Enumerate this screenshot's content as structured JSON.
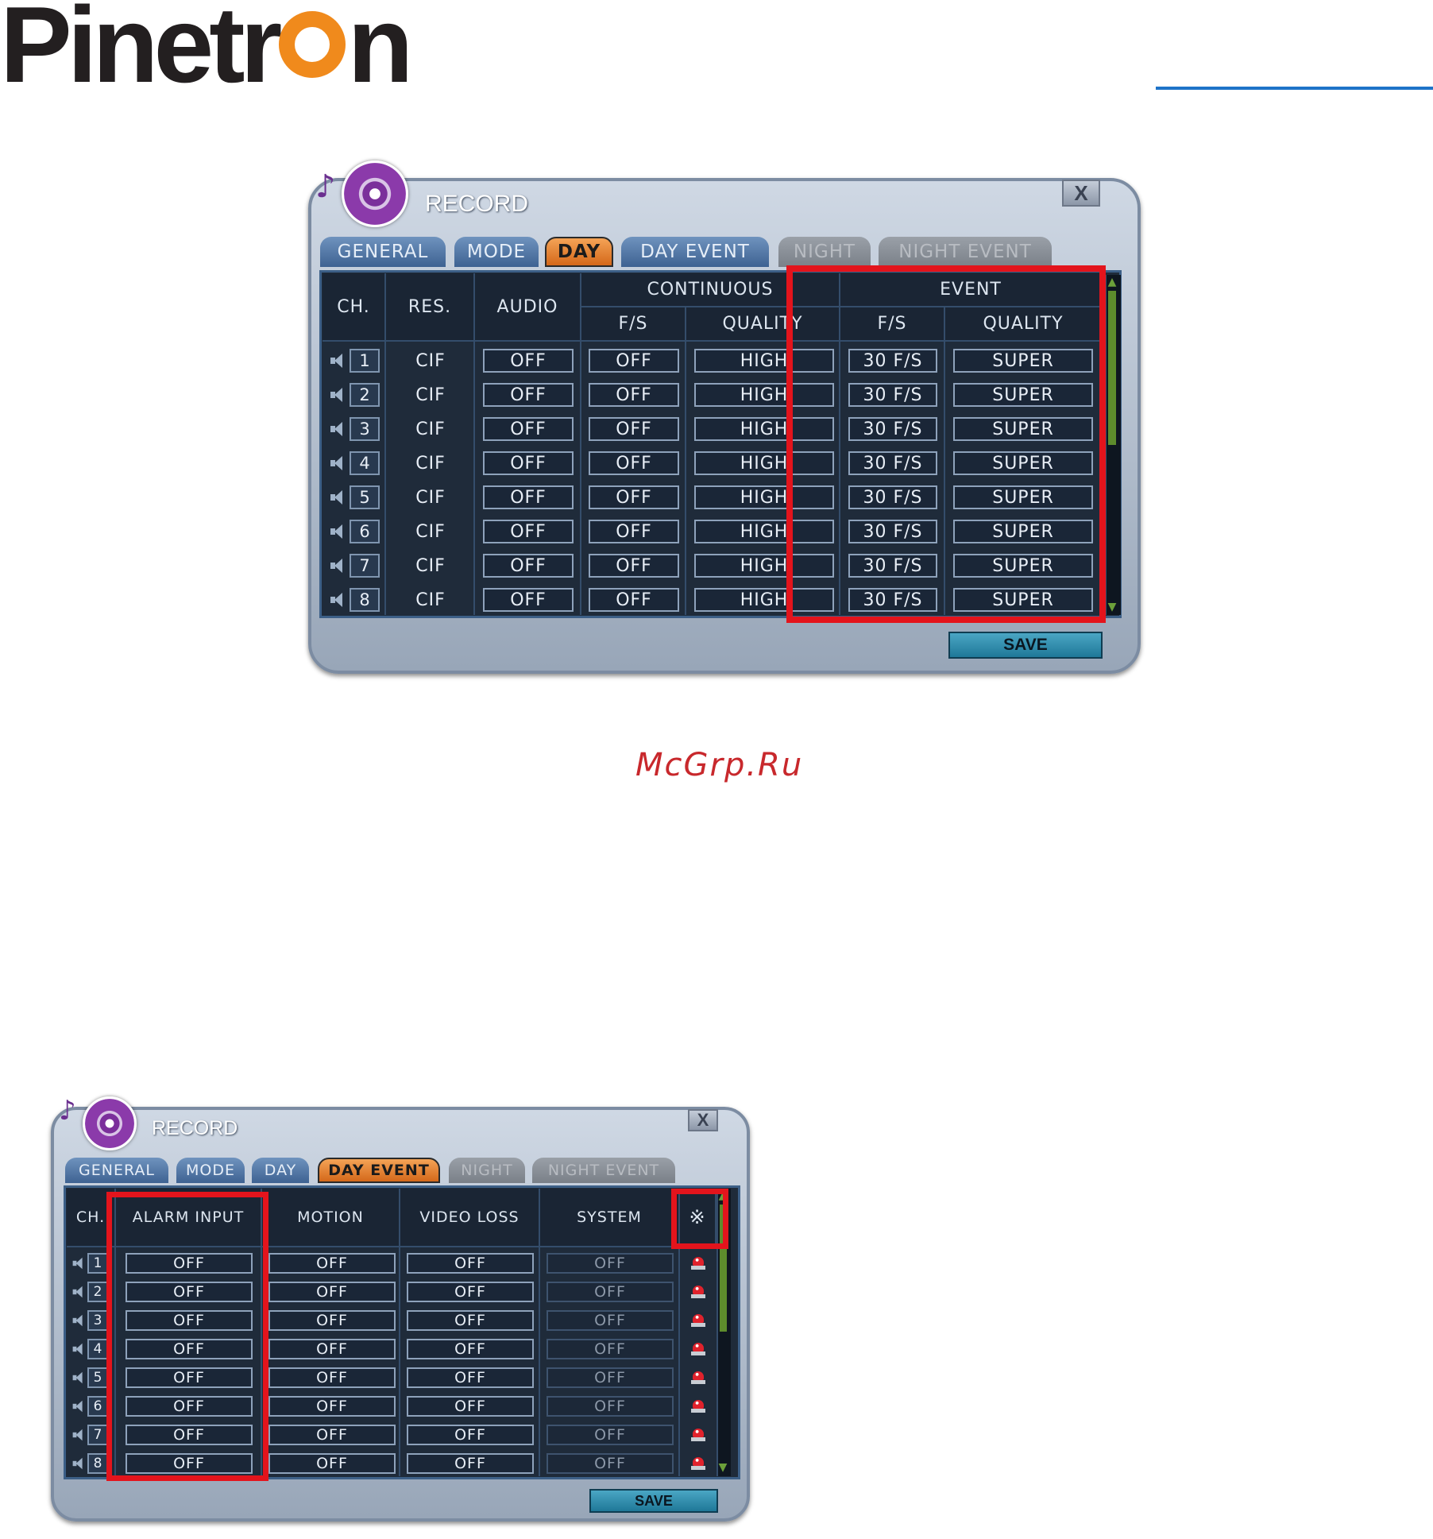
{
  "logo": {
    "text_start": "Pinetr",
    "text_end": "n"
  },
  "watermark": "McGrp.Ru",
  "window1": {
    "title": "RECORD",
    "close_label": "X",
    "tabs": [
      {
        "label": "GENERAL",
        "state": "normal"
      },
      {
        "label": "MODE",
        "state": "normal"
      },
      {
        "label": "DAY",
        "state": "active"
      },
      {
        "label": "DAY EVENT",
        "state": "normal"
      },
      {
        "label": "NIGHT",
        "state": "disabled"
      },
      {
        "label": "NIGHT EVENT",
        "state": "disabled"
      }
    ],
    "headers": {
      "ch": "CH.",
      "res": "RES.",
      "audio": "AUDIO",
      "continuous": "CONTINUOUS",
      "event": "EVENT",
      "cont_fs": "F/S",
      "cont_quality": "QUALITY",
      "event_fs": "F/S",
      "event_quality": "QUALITY"
    },
    "rows": [
      {
        "ch": "1",
        "res": "CIF",
        "audio": "OFF",
        "cont_fs": "OFF",
        "cont_quality": "HIGH",
        "event_fs": "30 F/S",
        "event_quality": "SUPER"
      },
      {
        "ch": "2",
        "res": "CIF",
        "audio": "OFF",
        "cont_fs": "OFF",
        "cont_quality": "HIGH",
        "event_fs": "30 F/S",
        "event_quality": "SUPER"
      },
      {
        "ch": "3",
        "res": "CIF",
        "audio": "OFF",
        "cont_fs": "OFF",
        "cont_quality": "HIGH",
        "event_fs": "30 F/S",
        "event_quality": "SUPER"
      },
      {
        "ch": "4",
        "res": "CIF",
        "audio": "OFF",
        "cont_fs": "OFF",
        "cont_quality": "HIGH",
        "event_fs": "30 F/S",
        "event_quality": "SUPER"
      },
      {
        "ch": "5",
        "res": "CIF",
        "audio": "OFF",
        "cont_fs": "OFF",
        "cont_quality": "HIGH",
        "event_fs": "30 F/S",
        "event_quality": "SUPER"
      },
      {
        "ch": "6",
        "res": "CIF",
        "audio": "OFF",
        "cont_fs": "OFF",
        "cont_quality": "HIGH",
        "event_fs": "30 F/S",
        "event_quality": "SUPER"
      },
      {
        "ch": "7",
        "res": "CIF",
        "audio": "OFF",
        "cont_fs": "OFF",
        "cont_quality": "HIGH",
        "event_fs": "30 F/S",
        "event_quality": "SUPER"
      },
      {
        "ch": "8",
        "res": "CIF",
        "audio": "OFF",
        "cont_fs": "OFF",
        "cont_quality": "HIGH",
        "event_fs": "30 F/S",
        "event_quality": "SUPER"
      }
    ],
    "save_label": "SAVE"
  },
  "window2": {
    "title": "RECORD",
    "close_label": "X",
    "tabs": [
      {
        "label": "GENERAL",
        "state": "normal"
      },
      {
        "label": "MODE",
        "state": "normal"
      },
      {
        "label": "DAY",
        "state": "normal"
      },
      {
        "label": "DAY EVENT",
        "state": "active"
      },
      {
        "label": "NIGHT",
        "state": "disabled"
      },
      {
        "label": "NIGHT EVENT",
        "state": "disabled"
      }
    ],
    "headers": {
      "ch": "CH.",
      "alarm_input": "ALARM INPUT",
      "motion": "MOTION",
      "video_loss": "VIDEO LOSS",
      "system": "SYSTEM",
      "special": "※"
    },
    "rows": [
      {
        "ch": "1",
        "alarm_input": "OFF",
        "motion": "OFF",
        "video_loss": "OFF",
        "system": "OFF"
      },
      {
        "ch": "2",
        "alarm_input": "OFF",
        "motion": "OFF",
        "video_loss": "OFF",
        "system": "OFF"
      },
      {
        "ch": "3",
        "alarm_input": "OFF",
        "motion": "OFF",
        "video_loss": "OFF",
        "system": "OFF"
      },
      {
        "ch": "4",
        "alarm_input": "OFF",
        "motion": "OFF",
        "video_loss": "OFF",
        "system": "OFF"
      },
      {
        "ch": "5",
        "alarm_input": "OFF",
        "motion": "OFF",
        "video_loss": "OFF",
        "system": "OFF"
      },
      {
        "ch": "6",
        "alarm_input": "OFF",
        "motion": "OFF",
        "video_loss": "OFF",
        "system": "OFF"
      },
      {
        "ch": "7",
        "alarm_input": "OFF",
        "motion": "OFF",
        "video_loss": "OFF",
        "system": "OFF"
      },
      {
        "ch": "8",
        "alarm_input": "OFF",
        "motion": "OFF",
        "video_loss": "OFF",
        "system": "OFF"
      }
    ],
    "save_label": "SAVE"
  },
  "colors": {
    "highlight": "#e3141c",
    "active_tab": "#e0782a",
    "logo_orange": "#f08a1c",
    "logo_dark": "#231f20",
    "header_rule": "#1e73c8"
  }
}
